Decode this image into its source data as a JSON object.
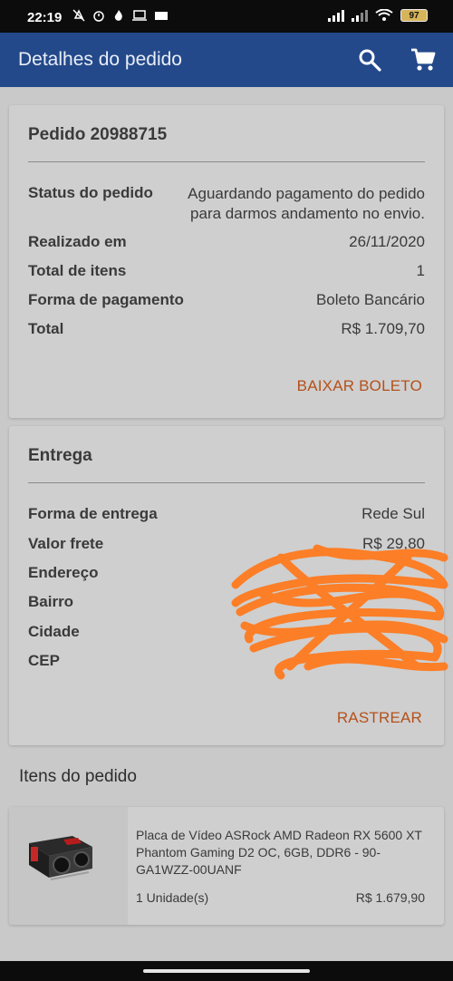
{
  "status_bar": {
    "time": "22:19",
    "battery": "97"
  },
  "app_bar": {
    "title": "Detalhes do pedido"
  },
  "order_card": {
    "title": "Pedido 20988715",
    "rows": [
      {
        "label": "Status do pedido",
        "value": "Aguardando pagamento do pedido para darmos andamento no envio."
      },
      {
        "label": "Realizado em",
        "value": "26/11/2020"
      },
      {
        "label": "Total de itens",
        "value": "1"
      },
      {
        "label": "Forma de pagamento",
        "value": "Boleto Bancário"
      },
      {
        "label": "Total",
        "value": "R$ 1.709,70"
      }
    ],
    "action": "BAIXAR BOLETO"
  },
  "delivery_card": {
    "title": "Entrega",
    "rows": [
      {
        "label": "Forma de entrega",
        "value": "Rede Sul"
      },
      {
        "label": "Valor frete",
        "value": "R$ 29,80"
      },
      {
        "label": "Endereço",
        "value": ""
      },
      {
        "label": "Bairro",
        "value": ""
      },
      {
        "label": "Cidade",
        "value": ""
      },
      {
        "label": "CEP",
        "value": ""
      }
    ],
    "action": "RASTREAR"
  },
  "items_section": {
    "title": "Itens do pedido",
    "items": [
      {
        "name": "Placa de Vídeo ASRock AMD Radeon RX 5600 XT Phantom Gaming D2 OC, 6GB, DDR6 - 90-GA1WZZ-00UANF",
        "quantity": "1 Unidade(s)",
        "price": "R$ 1.679,90"
      }
    ]
  },
  "colors": {
    "app_bar": "#23498a",
    "accent": "#b5501a",
    "scribble": "#ff7a1f"
  }
}
